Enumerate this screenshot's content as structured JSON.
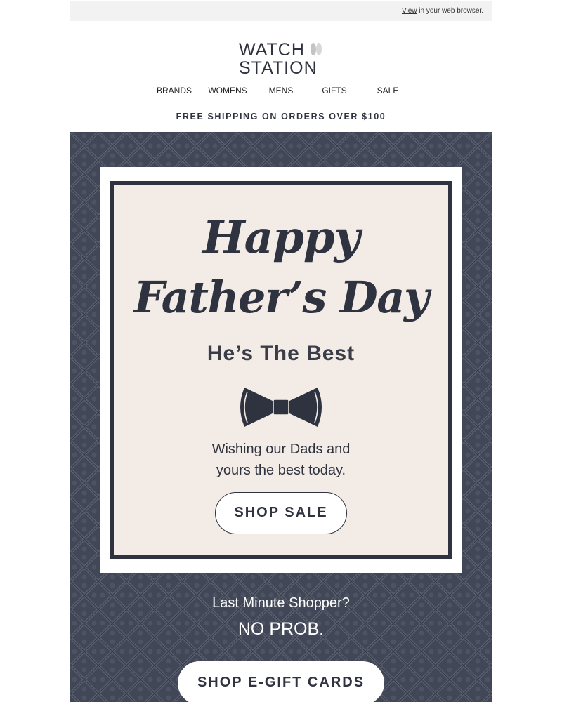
{
  "top_bar": {
    "view_link": "View",
    "rest": " in your web browser."
  },
  "logo": {
    "line1": "WATCH",
    "line2": "STATION"
  },
  "nav": [
    "BRANDS",
    "WOMENS",
    "MENS",
    "GIFTS",
    "SALE"
  ],
  "shipping_banner": "FREE SHIPPING ON ORDERS OVER $100",
  "hero": {
    "script_line1": "Happy",
    "script_line2": "Father’s Day",
    "tagline": "He’s The Best",
    "message_line1": "Wishing our Dads and",
    "message_line2": "yours the best today.",
    "cta": "SHOP SALE"
  },
  "promo": {
    "question": "Last Minute Shopper?",
    "answer": "NO PROB.",
    "cta": "SHOP E-GIFT CARDS"
  },
  "colors": {
    "navy": "#2f3340",
    "hero_background": "#414757",
    "card_background": "#f2ebe6",
    "top_bar": "#f2f2f2"
  },
  "icons": [
    "watch-hands-logo-icon",
    "bowtie-icon"
  ]
}
